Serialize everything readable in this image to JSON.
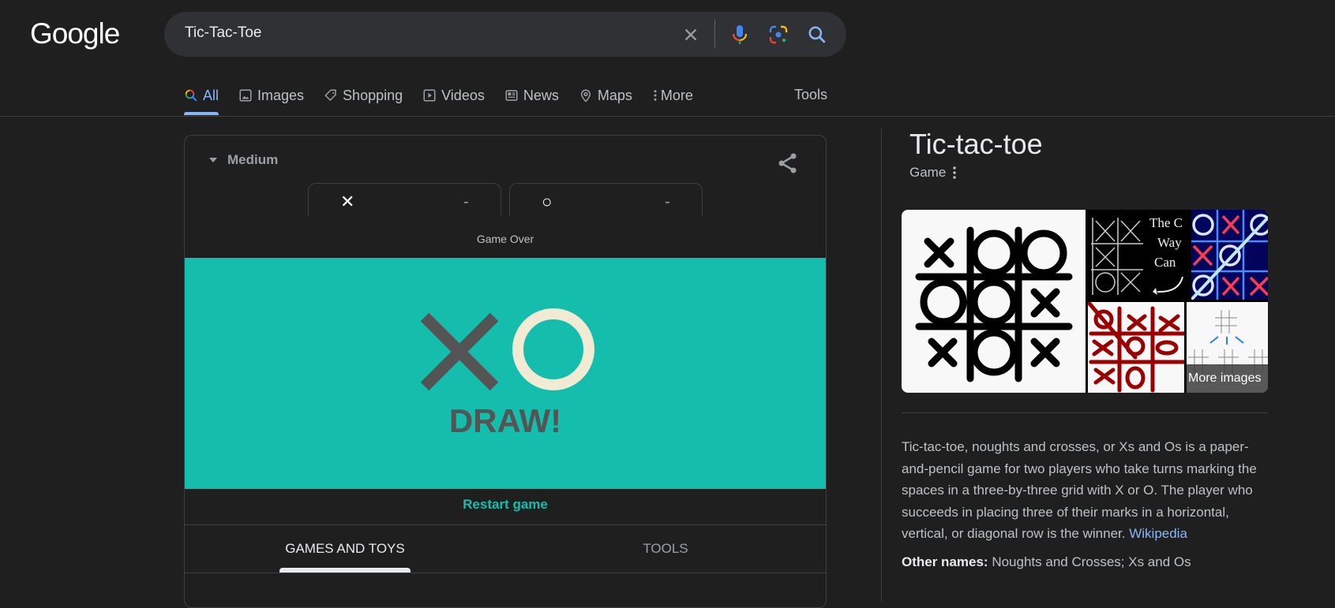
{
  "header": {
    "logo": "Google",
    "search": {
      "query": "Tic-Tac-Toe"
    },
    "icons": [
      "clear-icon",
      "microphone-icon",
      "lens-icon",
      "search-icon"
    ]
  },
  "tabs": [
    {
      "label": "All",
      "icon": "search-icon",
      "active": true
    },
    {
      "label": "Images",
      "icon": "image-icon"
    },
    {
      "label": "Shopping",
      "icon": "tag-icon"
    },
    {
      "label": "Videos",
      "icon": "play-icon"
    },
    {
      "label": "News",
      "icon": "news-icon"
    },
    {
      "label": "Maps",
      "icon": "pin-icon"
    },
    {
      "label": "More",
      "icon": "more-vert-icon"
    }
  ],
  "tools_label": "Tools",
  "game": {
    "difficulty": "Medium",
    "players": [
      {
        "mark": "✕",
        "score": "-"
      },
      {
        "mark": "○",
        "score": "-"
      }
    ],
    "status": "Game Over",
    "result": "DRAW!",
    "restart_label": "Restart game",
    "bottom_tabs": [
      {
        "label": "GAMES AND TOYS",
        "active": true
      },
      {
        "label": "TOOLS",
        "active": false
      }
    ],
    "colors": {
      "panel": "#14bdac",
      "x": "#545454",
      "o": "#f2ebd3"
    }
  },
  "knowledge_panel": {
    "title": "Tic-tac-toe",
    "subtitle": "Game",
    "more_images_label": "More images",
    "image_texts": [
      "The C",
      "Way",
      "Can"
    ],
    "description": "Tic-tac-toe, noughts and crosses, or Xs and Os is a paper-and-pencil game for two players who take turns marking the spaces in a three-by-three grid with X or O. The player who succeeds in placing three of their marks in a horizontal, vertical, or diagonal row is the winner.",
    "source_link": "Wikipedia",
    "other_names_label": "Other names:",
    "other_names": "Noughts and Crosses; Xs and Os"
  }
}
